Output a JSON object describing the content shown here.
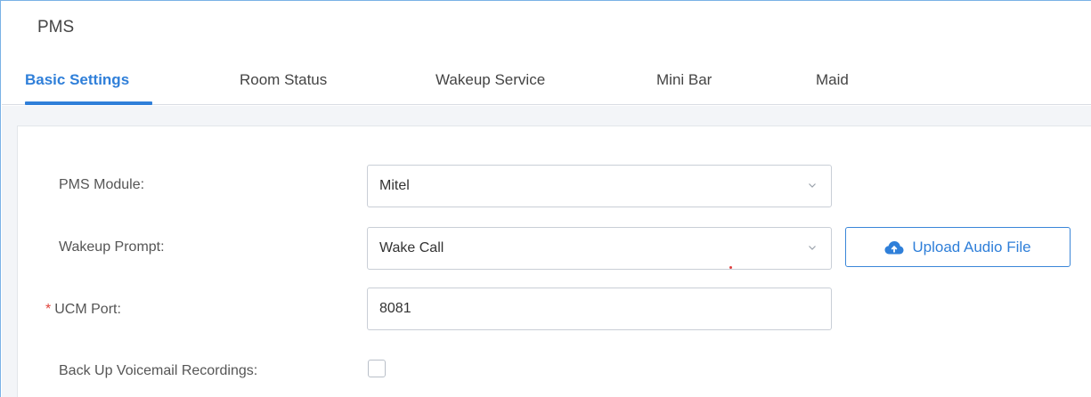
{
  "page": {
    "title": "PMS"
  },
  "tabs": [
    {
      "label": "Basic Settings",
      "active": true
    },
    {
      "label": "Room Status",
      "active": false
    },
    {
      "label": "Wakeup Service",
      "active": false
    },
    {
      "label": "Mini Bar",
      "active": false
    },
    {
      "label": "Maid",
      "active": false
    }
  ],
  "form": {
    "pms_module": {
      "label": "PMS Module:",
      "value": "Mitel"
    },
    "wakeup_prompt": {
      "label": "Wakeup Prompt:",
      "value": "Wake Call"
    },
    "upload_button": {
      "label": "Upload Audio File",
      "icon": "cloud-upload-icon"
    },
    "ucm_port": {
      "label": "UCM Port:",
      "value": "8081",
      "required_mark": "*"
    },
    "backup_voicemail": {
      "label": "Back Up Voicemail Recordings:",
      "checked": false
    }
  },
  "colors": {
    "accent": "#2f7fd9",
    "required": "#e0433b",
    "border": "#c9ced6"
  }
}
